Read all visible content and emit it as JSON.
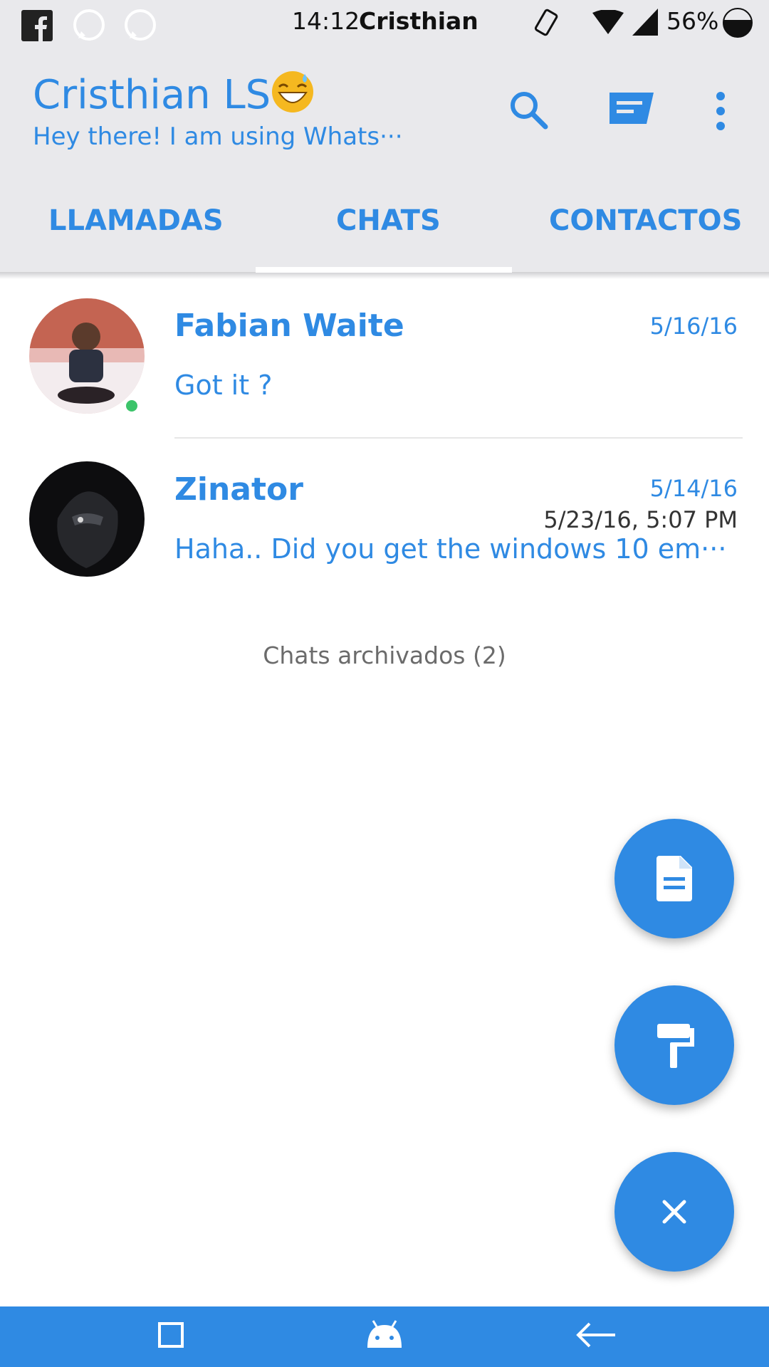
{
  "colors": {
    "accent": "#2f8ae3",
    "status_bar_bg": "#e9e9ec",
    "nav_bar": "#2f8ae3"
  },
  "status_bar": {
    "time": "14:12",
    "carrier": "Cristhian",
    "battery": "56%",
    "left_icons": [
      "facebook-icon",
      "whatsapp-icon",
      "whatsapp-icon"
    ],
    "right_icons": [
      "vibrate-icon",
      "wifi-icon",
      "signal-icon",
      "battery-icon"
    ]
  },
  "app_bar": {
    "title": "Cristhian LS",
    "title_emoji": "grinning-sweat-emoji",
    "subtitle": "Hey there! I am using Whats···",
    "actions": [
      "search-icon",
      "message-icon",
      "more-vert-icon"
    ]
  },
  "tabs": [
    {
      "label": "LLAMADAS",
      "selected": false
    },
    {
      "label": "CHATS",
      "selected": true
    },
    {
      "label": "CONTACTOS",
      "selected": false
    }
  ],
  "chats": [
    {
      "name": "Fabian Waite",
      "date": "5/16/16",
      "message": "Got it ?",
      "online": true
    },
    {
      "name": "Zinator",
      "date": "5/14/16",
      "last_seen": "5/23/16, 5:07 PM",
      "message": "Haha.. Did you get the windows 10 em···"
    }
  ],
  "archived_label": "Chats archivados (2)",
  "fabs": [
    "note-icon",
    "paint-roller-icon",
    "close-icon"
  ],
  "nav_bar": [
    "recent-apps-icon",
    "android-icon",
    "back-icon"
  ]
}
